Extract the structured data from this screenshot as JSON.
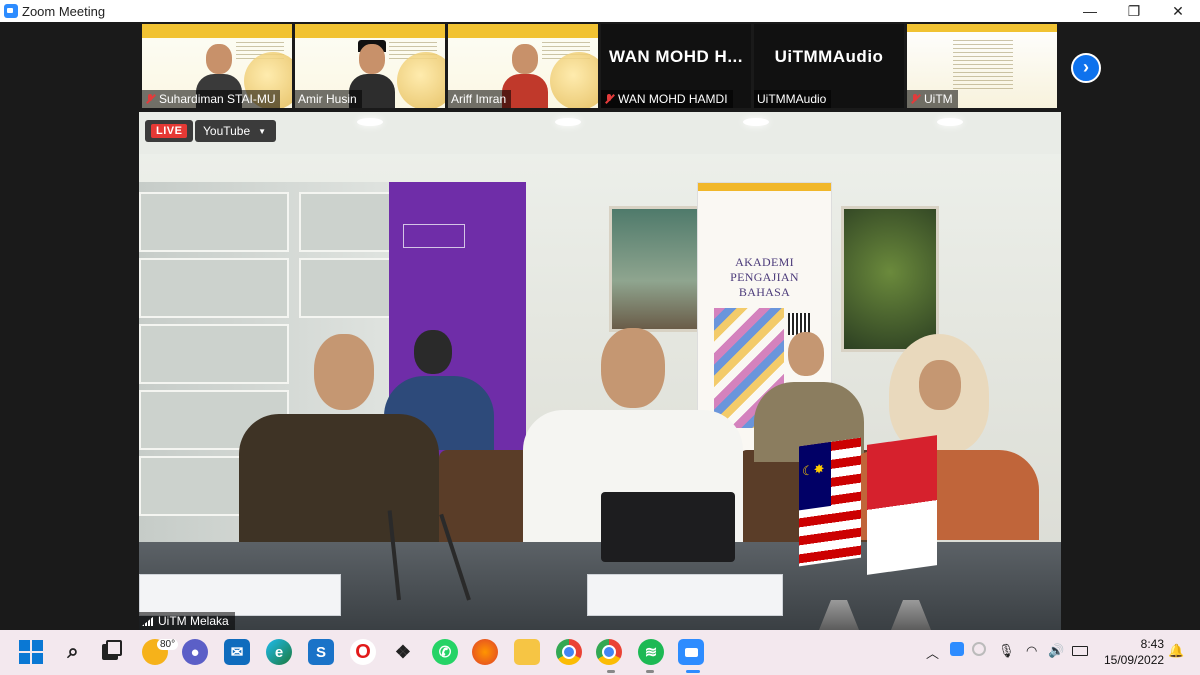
{
  "window": {
    "title": "Zoom Meeting",
    "minimize_glyph": "—",
    "restore_glyph": "❐",
    "close_glyph": "✕"
  },
  "gallery": {
    "participants": [
      {
        "name": "Suhardiman STAI-MU",
        "muted": true
      },
      {
        "name": "Amir Husin",
        "muted": false
      },
      {
        "name": "Ariff Imran",
        "muted": false
      },
      {
        "name": "WAN MOHD HAMDI",
        "display": "WAN MOHD H...",
        "muted": true
      },
      {
        "name": "UiTMMAudio",
        "display": "UiTMMAudio",
        "muted": false
      },
      {
        "name": "UiTM",
        "muted": true
      }
    ],
    "next_glyph": "›"
  },
  "main_video": {
    "live_label": "LIVE",
    "stream_label": "YouTube",
    "caret_glyph": "▼",
    "speaker_name": "UiTM Melaka",
    "banner_text": "AKADEMI PENGAJIAN BAHASA"
  },
  "taskbar": {
    "weather_temp": "80°",
    "icons": [
      "windows-start-icon",
      "search-icon",
      "task-view-icon",
      "weather-icon",
      "teams-chat-icon",
      "mail-icon",
      "edge-icon",
      "app-s-icon",
      "opera-icon",
      "dropbox-icon",
      "whatsapp-icon",
      "firefox-icon",
      "file-explorer-icon",
      "chrome-icon",
      "chrome-profile-icon",
      "spotify-icon",
      "zoom-icon"
    ],
    "time": "8:43",
    "date": "15/09/2022"
  },
  "colors": {
    "zoom_blue": "#2d8cff",
    "live_red": "#e53935",
    "muted_red": "#e23b3b",
    "next_button_blue": "#0e72ed",
    "taskbar_bg": "#f3e8ee"
  }
}
